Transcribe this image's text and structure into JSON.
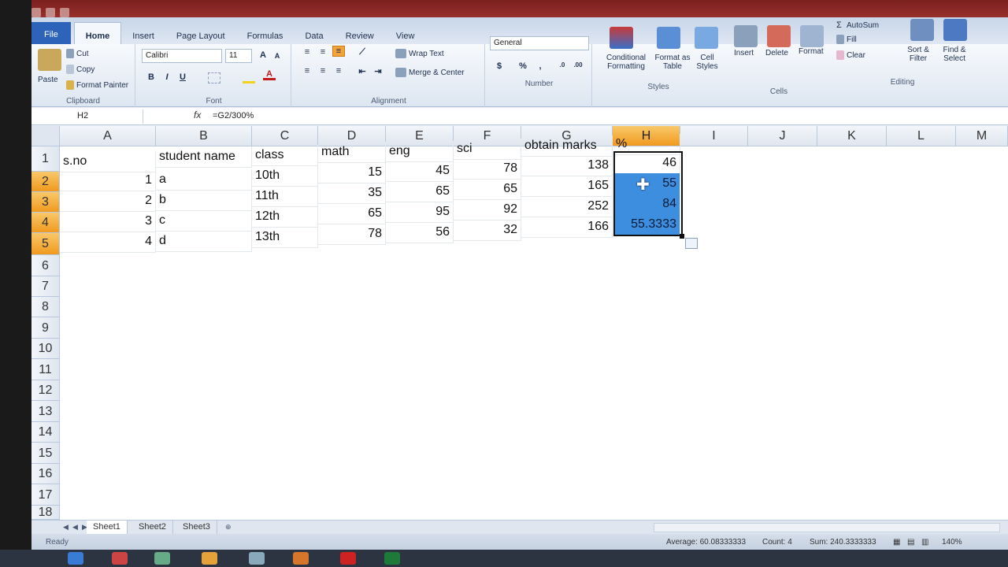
{
  "ribbon": {
    "tabs": [
      "File",
      "Home",
      "Insert",
      "Page Layout",
      "Formulas",
      "Data",
      "Review",
      "View"
    ],
    "clipboard": {
      "paste": "Paste",
      "cut": "Cut",
      "copy": "Copy",
      "format_painter": "Format Painter",
      "label": "Clipboard"
    },
    "font": {
      "name": "Calibri",
      "size": "11",
      "label": "Font",
      "bold": "B",
      "italic": "I",
      "underline": "U"
    },
    "alignment": {
      "wrap_text": "Wrap Text",
      "merge_center": "Merge & Center",
      "label": "Alignment"
    },
    "number": {
      "format": "General",
      "currency": "$",
      "percent": "%",
      "comma": ",",
      "label": "Number"
    },
    "styles": {
      "conditional": "Conditional Formatting",
      "format_table": "Format as Table",
      "cell_styles": "Cell Styles",
      "label": "Styles"
    },
    "cells": {
      "insert": "Insert",
      "delete": "Delete",
      "format": "Format",
      "label": "Cells"
    },
    "editing": {
      "autosum": "AutoSum",
      "fill": "Fill",
      "clear": "Clear",
      "sort_filter": "Sort & Filter",
      "find_select": "Find & Select",
      "label": "Editing"
    }
  },
  "formula_bar": {
    "name_box": "H2",
    "fx": "fx",
    "formula": "=G2/300%"
  },
  "columns": [
    "A",
    "B",
    "C",
    "D",
    "E",
    "F",
    "G",
    "H",
    "I",
    "J",
    "K",
    "L",
    "M"
  ],
  "rows": [
    "1",
    "2",
    "3",
    "4",
    "5",
    "6",
    "7",
    "8",
    "9",
    "10",
    "11",
    "12",
    "13",
    "14",
    "15",
    "16",
    "17",
    "18"
  ],
  "table": {
    "header": [
      "s.no",
      "student name",
      "class",
      "math",
      "eng",
      "sci",
      "obtain marks",
      "%"
    ],
    "data": [
      [
        "1",
        "a",
        "10th",
        "15",
        "45",
        "78",
        "138",
        "46"
      ],
      [
        "2",
        "b",
        "11th",
        "35",
        "65",
        "65",
        "165",
        "55"
      ],
      [
        "3",
        "c",
        "12th",
        "65",
        "95",
        "92",
        "252",
        "84"
      ],
      [
        "4",
        "d",
        "13th",
        "78",
        "56",
        "32",
        "166",
        "55.3333"
      ]
    ]
  },
  "sheets": [
    "Sheet1",
    "Sheet2",
    "Sheet3"
  ],
  "status": {
    "ready": "Ready",
    "average": "Average: 60.08333333",
    "count": "Count: 4",
    "sum": "Sum: 240.3333333",
    "zoom": "140%"
  },
  "colors": {
    "selection": "#3e8ee0",
    "header_selected": "#f09a1e",
    "file_tab": "#2d63b8"
  }
}
